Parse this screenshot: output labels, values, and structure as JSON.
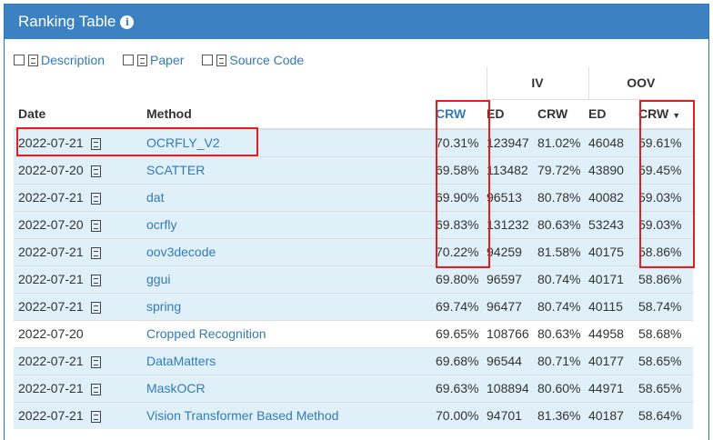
{
  "panel": {
    "title": "Ranking Table"
  },
  "links": [
    {
      "label": "Description",
      "icon": "description-icon"
    },
    {
      "label": "Paper",
      "icon": "pdf-icon"
    },
    {
      "label": "Source Code",
      "icon": "code-file-icon"
    }
  ],
  "table": {
    "groups": {
      "iv": "IV",
      "oov": "OOV"
    },
    "columns": [
      "Date",
      "Method",
      "CRW",
      "ED",
      "CRW",
      "ED",
      "CRW"
    ],
    "rows": [
      {
        "date": "2022-07-21",
        "doc": true,
        "method": "OCRFLY_V2",
        "crw": "70.31%",
        "iv_ed": "123947",
        "iv_crw": "81.02%",
        "oov_ed": "46048",
        "oov_crw": "59.61%",
        "hl": true
      },
      {
        "date": "2022-07-20",
        "doc": true,
        "method": "SCATTER",
        "crw": "69.58%",
        "iv_ed": "113482",
        "iv_crw": "79.72%",
        "oov_ed": "43890",
        "oov_crw": "59.45%",
        "hl": true
      },
      {
        "date": "2022-07-21",
        "doc": true,
        "method": "dat",
        "crw": "69.90%",
        "iv_ed": "96513",
        "iv_crw": "80.78%",
        "oov_ed": "40082",
        "oov_crw": "59.03%",
        "hl": true
      },
      {
        "date": "2022-07-20",
        "doc": true,
        "method": "ocrfly",
        "crw": "69.83%",
        "iv_ed": "131232",
        "iv_crw": "80.63%",
        "oov_ed": "53243",
        "oov_crw": "59.03%",
        "hl": true
      },
      {
        "date": "2022-07-21",
        "doc": true,
        "method": "oov3decode",
        "crw": "70.22%",
        "iv_ed": "94259",
        "iv_crw": "81.58%",
        "oov_ed": "40175",
        "oov_crw": "58.86%",
        "hl": true
      },
      {
        "date": "2022-07-21",
        "doc": true,
        "method": "ggui",
        "crw": "69.80%",
        "iv_ed": "96597",
        "iv_crw": "80.74%",
        "oov_ed": "40171",
        "oov_crw": "58.86%",
        "hl": true
      },
      {
        "date": "2022-07-21",
        "doc": true,
        "method": "spring",
        "crw": "69.74%",
        "iv_ed": "96477",
        "iv_crw": "80.74%",
        "oov_ed": "40115",
        "oov_crw": "58.74%",
        "hl": true
      },
      {
        "date": "2022-07-20",
        "doc": false,
        "method": "Cropped Recognition",
        "crw": "69.65%",
        "iv_ed": "108766",
        "iv_crw": "80.63%",
        "oov_ed": "44958",
        "oov_crw": "58.68%",
        "hl": false
      },
      {
        "date": "2022-07-21",
        "doc": true,
        "method": "DataMatters",
        "crw": "69.68%",
        "iv_ed": "96544",
        "iv_crw": "80.71%",
        "oov_ed": "40177",
        "oov_crw": "58.65%",
        "hl": true
      },
      {
        "date": "2022-07-21",
        "doc": true,
        "method": "MaskOCR",
        "crw": "69.63%",
        "iv_ed": "108894",
        "iv_crw": "80.60%",
        "oov_ed": "44971",
        "oov_crw": "58.65%",
        "hl": true
      },
      {
        "date": "2022-07-21",
        "doc": true,
        "method": "Vision Transformer Based Method",
        "crw": "70.00%",
        "iv_ed": "94701",
        "iv_crw": "81.36%",
        "oov_ed": "40187",
        "oov_crw": "58.64%",
        "hl": true
      }
    ]
  },
  "colors": {
    "header": "#3c82c3",
    "link": "#337ab7",
    "highlight": "#dff0f8",
    "annotation": "#e02020"
  }
}
